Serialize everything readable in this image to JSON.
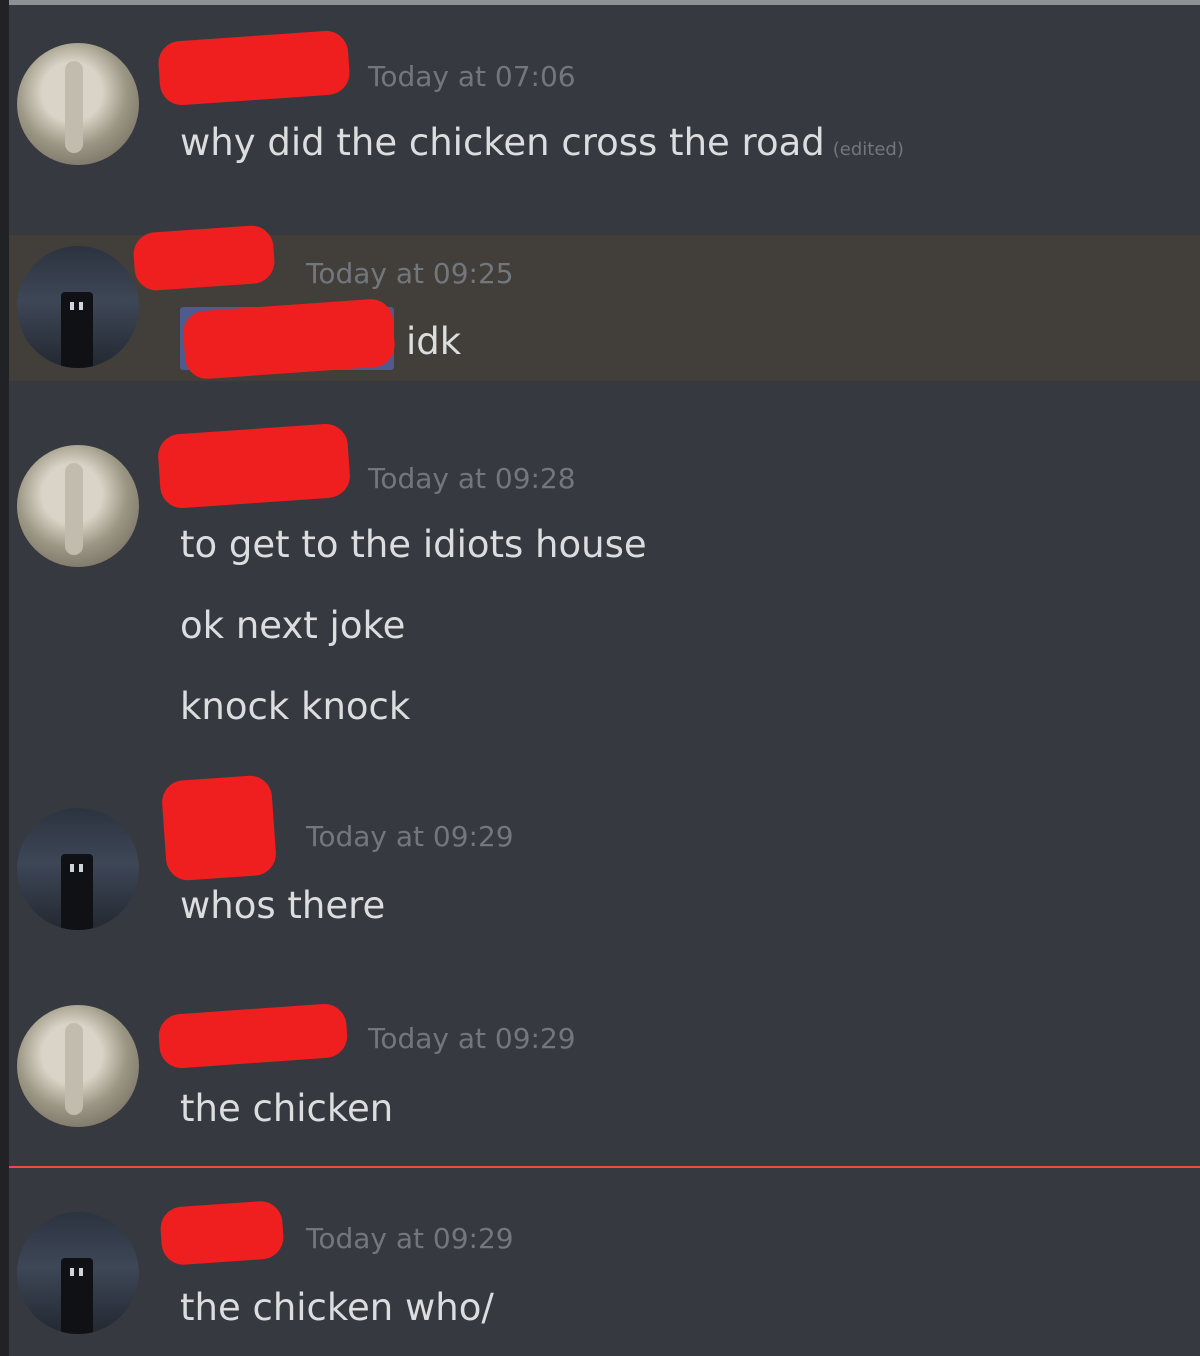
{
  "messages": [
    {
      "timestamp": "Today at 07:06",
      "lines": [
        "why did the chicken cross the road"
      ],
      "edited_label": "(edited)"
    },
    {
      "timestamp": "Today at 09:25",
      "lines": [
        "idk"
      ]
    },
    {
      "timestamp": "Today at 09:28",
      "lines": [
        "to get to the idiots house",
        "ok next joke",
        "knock knock"
      ]
    },
    {
      "timestamp": "Today at 09:29",
      "lines": [
        "whos there"
      ]
    },
    {
      "timestamp": "Today at 09:29",
      "lines": [
        "the chicken"
      ]
    },
    {
      "timestamp": "Today at 09:29",
      "lines": [
        "the chicken who/"
      ]
    }
  ],
  "colors": {
    "background": "#36393f",
    "highlight": "#423f3a",
    "new_messages_divider": "#f04747",
    "redaction": "#ef1f1f"
  }
}
